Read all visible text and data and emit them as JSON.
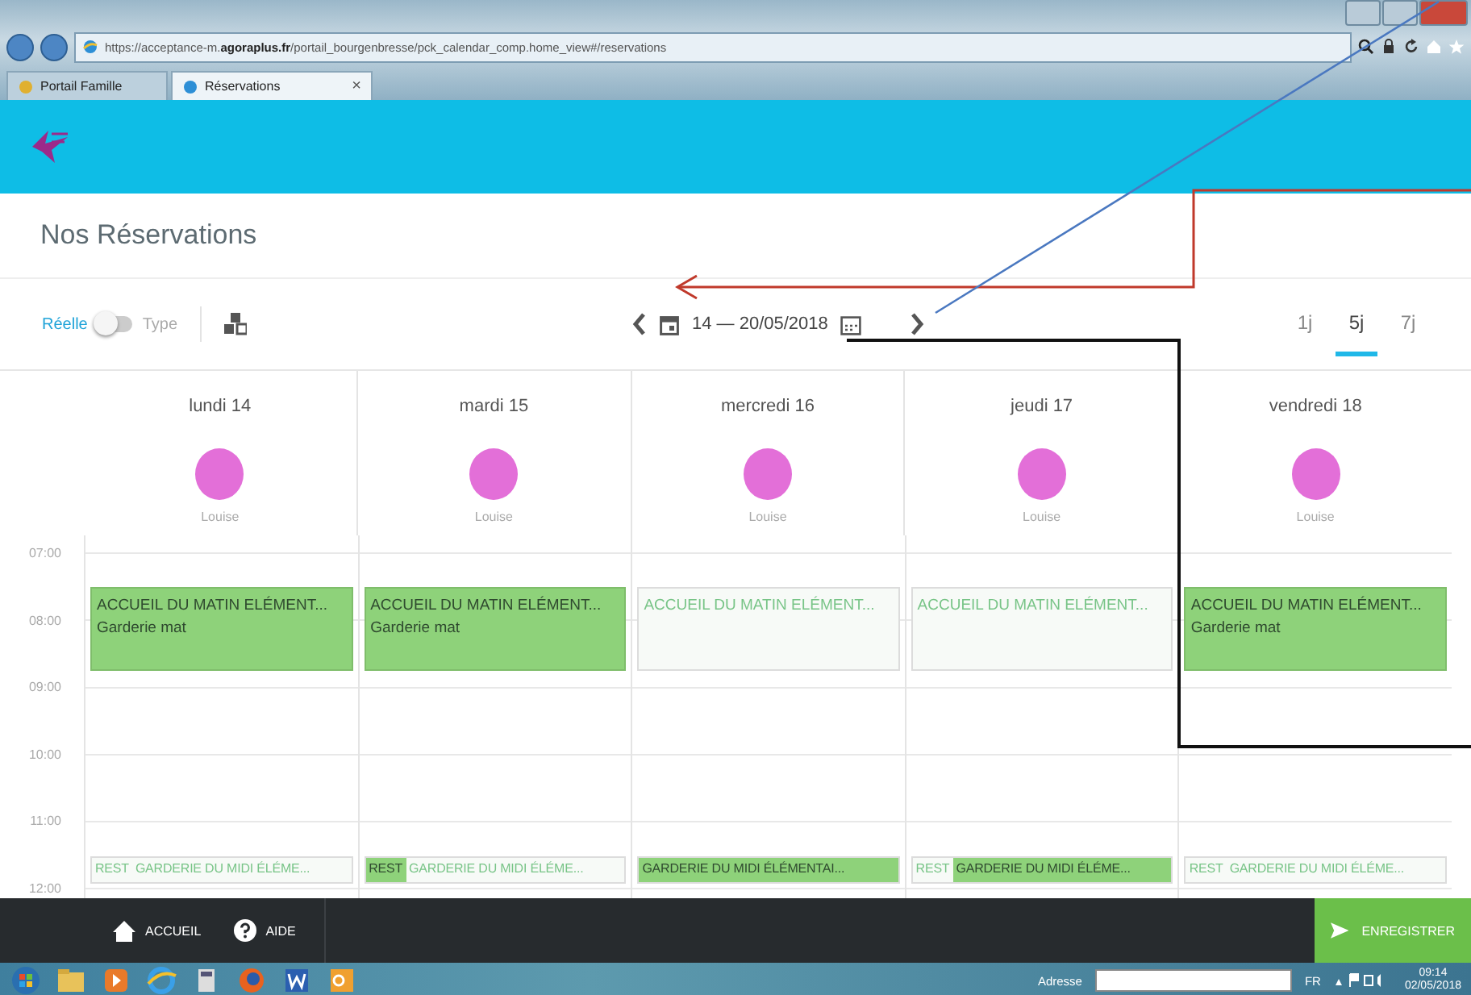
{
  "browser": {
    "url": "https://acceptance-m.**agoraplus.fr**/portail_bourgenbresse/pck_calendar_comp.home_view#/reservations",
    "tabs": [
      {
        "label": "Portail Famille",
        "selected": false,
        "closable": false
      },
      {
        "label": "Réservations",
        "selected": true,
        "closable": true
      }
    ],
    "close_glyph": "×"
  },
  "page": {
    "title": "Nos Réservations"
  },
  "toolbar": {
    "left_label": "Réelle",
    "right_label": "Type",
    "toggle_on": false,
    "date_range": "14 — 20/05/2018",
    "views": [
      {
        "label": "1j",
        "selected": false
      },
      {
        "label": "5j",
        "selected": true
      },
      {
        "label": "7j",
        "selected": false
      }
    ]
  },
  "hours": [
    "07:00",
    "08:00",
    "09:00",
    "10:00",
    "11:00",
    "12:00"
  ],
  "days": [
    {
      "name": "lundi 14",
      "child": "Louise",
      "morning": {
        "title": "ACCUEIL DU MATIN ELÉMENT...",
        "subtitle": "Garderie mat",
        "booked": true
      },
      "noon": [
        {
          "label": "REST",
          "booked": false
        },
        {
          "label": "GARDERIE DU MIDI ÉLÉME...",
          "booked": false
        }
      ]
    },
    {
      "name": "mardi 15",
      "child": "Louise",
      "morning": {
        "title": "ACCUEIL DU MATIN ELÉMENT...",
        "subtitle": "Garderie mat",
        "booked": true
      },
      "noon": [
        {
          "label": "REST",
          "booked": true
        },
        {
          "label": "GARDERIE DU MIDI ÉLÉME...",
          "booked": false
        }
      ]
    },
    {
      "name": "mercredi 16",
      "child": "Louise",
      "morning": {
        "title": "ACCUEIL DU MATIN ELÉMENT...",
        "booked": false
      },
      "noon": [
        {
          "label": "GARDERIE DU MIDI ÉLÉMENTAI...",
          "booked": true
        }
      ]
    },
    {
      "name": "jeudi 17",
      "child": "Louise",
      "morning": {
        "title": "ACCUEIL DU MATIN ELÉMENT...",
        "booked": false
      },
      "noon": [
        {
          "label": "REST",
          "booked": false
        },
        {
          "label": "GARDERIE DU MIDI ÉLÉME...",
          "booked": true
        }
      ]
    },
    {
      "name": "vendredi 18",
      "child": "Louise",
      "morning": {
        "title": "ACCUEIL DU MATIN ELÉMENT...",
        "subtitle": "Garderie mat",
        "booked": true
      },
      "noon": [
        {
          "label": "REST",
          "booked": false
        },
        {
          "label": "GARDERIE DU MIDI ÉLÉME...",
          "booked": false
        }
      ]
    }
  ],
  "footer": {
    "links": [
      {
        "kind": "home",
        "label": "ACCUEIL"
      },
      {
        "kind": "help",
        "label": "AIDE"
      }
    ],
    "save": "ENREGISTRER"
  },
  "taskbar": {
    "address_label": "Adresse",
    "language": "FR",
    "time": "09:14",
    "date": "02/05/2018"
  }
}
